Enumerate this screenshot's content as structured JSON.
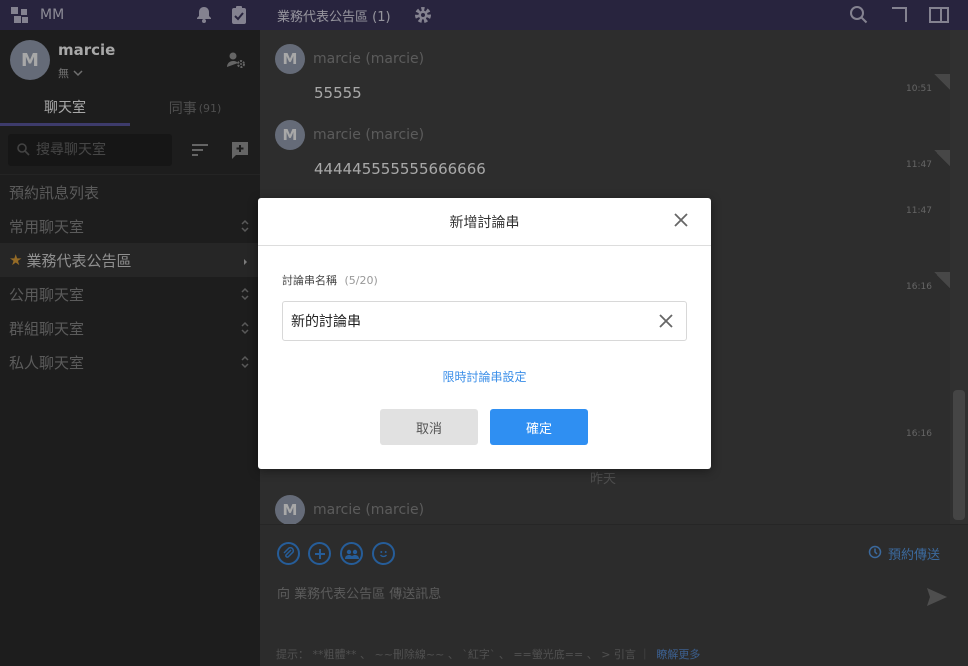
{
  "app": {
    "name": "MM"
  },
  "header": {
    "channel_title": "業務代表公告區 (1)"
  },
  "profile": {
    "avatar_letter": "M",
    "username": "marcie",
    "status": "無"
  },
  "tabs": [
    {
      "label": "聊天室"
    },
    {
      "label": "同事",
      "count": "(91)"
    }
  ],
  "search": {
    "placeholder": "搜尋聊天室"
  },
  "sidebar": {
    "items": [
      {
        "label": "預約訊息列表"
      },
      {
        "label": "常用聊天室"
      },
      {
        "label": "業務代表公告區"
      },
      {
        "label": "公用聊天室"
      },
      {
        "label": "群組聊天室"
      },
      {
        "label": "私人聊天室"
      }
    ]
  },
  "messages": [
    {
      "avatar": "M",
      "name": "marcie (marcie)",
      "text": "55555",
      "time": "10:51"
    },
    {
      "avatar": "M",
      "name": "marcie (marcie)",
      "text": "444445555555666666",
      "time": "11:47"
    },
    {
      "time": "11:47"
    },
    {
      "time": "16:16"
    },
    {
      "time": "16:16"
    },
    {
      "avatar": "M",
      "name": "marcie (marcie)"
    }
  ],
  "date_separator": "昨天",
  "composer": {
    "schedule_label": "預約傳送",
    "placeholder": "向 業務代表公告區 傳送訊息"
  },
  "hint": {
    "text": "提示： **粗體** 、 ~~刪除線~~ 、 `紅字` 、 ==螢光底== 、 > 引言  ｜",
    "link": "瞭解更多"
  },
  "dialog": {
    "title": "新增討論串",
    "field_label": "討論串名稱",
    "field_count": "(5/20)",
    "field_value": "新的討論串",
    "timed_link": "限時討論串設定",
    "cancel_label": "取消",
    "confirm_label": "確定"
  },
  "colors": {
    "topbar": "#3e385f",
    "sidebar": "#2c2c2c",
    "accent_blue": "#2f8ff2",
    "star": "#e3a33a"
  }
}
